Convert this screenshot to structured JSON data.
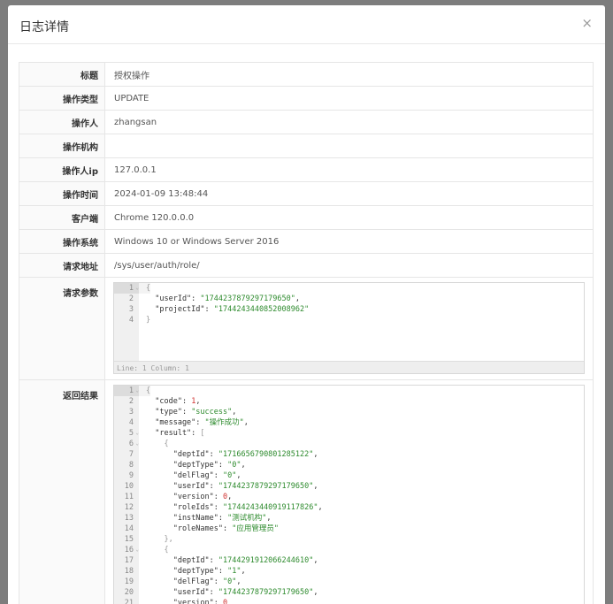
{
  "dialog": {
    "title": "日志详情",
    "close_glyph": "×"
  },
  "fields": [
    {
      "label": "标题",
      "value": "授权操作"
    },
    {
      "label": "操作类型",
      "value": "UPDATE"
    },
    {
      "label": "操作人",
      "value": "zhangsan"
    },
    {
      "label": "操作机构",
      "value": ""
    },
    {
      "label": "操作人ip",
      "value": "127.0.0.1"
    },
    {
      "label": "操作时间",
      "value": "2024-01-09 13:48:44"
    },
    {
      "label": "客户端",
      "value": "Chrome 120.0.0.0"
    },
    {
      "label": "操作系统",
      "value": "Windows 10 or Windows Server 2016"
    },
    {
      "label": "请求地址",
      "value": "/sys/user/auth/role/"
    }
  ],
  "request_params": {
    "label": "请求参数",
    "status": "Line: 1  Column: 1",
    "lines": [
      {
        "n": "1",
        "fold": true,
        "tokens": [
          {
            "t": "brk",
            "v": "{"
          }
        ]
      },
      {
        "n": "2",
        "fold": false,
        "tokens": [
          {
            "t": "key",
            "v": "  \"userId\": "
          },
          {
            "t": "str",
            "v": "\"1744237879297179650\""
          },
          {
            "t": "key",
            "v": ","
          }
        ]
      },
      {
        "n": "3",
        "fold": false,
        "tokens": [
          {
            "t": "key",
            "v": "  \"projectId\": "
          },
          {
            "t": "str",
            "v": "\"1744243440852008962\""
          }
        ]
      },
      {
        "n": "4",
        "fold": false,
        "tokens": [
          {
            "t": "brk",
            "v": "}"
          }
        ]
      }
    ]
  },
  "response": {
    "label": "返回结果",
    "lines": [
      {
        "n": "1",
        "fold": true,
        "tokens": [
          {
            "t": "brk",
            "v": "{"
          }
        ]
      },
      {
        "n": "2",
        "fold": false,
        "tokens": [
          {
            "t": "key",
            "v": "  \"code\": "
          },
          {
            "t": "num",
            "v": "1"
          },
          {
            "t": "key",
            "v": ","
          }
        ]
      },
      {
        "n": "3",
        "fold": false,
        "tokens": [
          {
            "t": "key",
            "v": "  \"type\": "
          },
          {
            "t": "str",
            "v": "\"success\""
          },
          {
            "t": "key",
            "v": ","
          }
        ]
      },
      {
        "n": "4",
        "fold": false,
        "tokens": [
          {
            "t": "key",
            "v": "  \"message\": "
          },
          {
            "t": "str",
            "v": "\"操作成功\""
          },
          {
            "t": "key",
            "v": ","
          }
        ]
      },
      {
        "n": "5",
        "fold": true,
        "tokens": [
          {
            "t": "key",
            "v": "  \"result\": "
          },
          {
            "t": "brk",
            "v": "["
          }
        ]
      },
      {
        "n": "6",
        "fold": true,
        "tokens": [
          {
            "t": "brk",
            "v": "    {"
          }
        ]
      },
      {
        "n": "7",
        "fold": false,
        "tokens": [
          {
            "t": "key",
            "v": "      \"deptId\": "
          },
          {
            "t": "str",
            "v": "\"1716656790801285122\""
          },
          {
            "t": "key",
            "v": ","
          }
        ]
      },
      {
        "n": "8",
        "fold": false,
        "tokens": [
          {
            "t": "key",
            "v": "      \"deptType\": "
          },
          {
            "t": "str",
            "v": "\"0\""
          },
          {
            "t": "key",
            "v": ","
          }
        ]
      },
      {
        "n": "9",
        "fold": false,
        "tokens": [
          {
            "t": "key",
            "v": "      \"delFlag\": "
          },
          {
            "t": "str",
            "v": "\"0\""
          },
          {
            "t": "key",
            "v": ","
          }
        ]
      },
      {
        "n": "10",
        "fold": false,
        "tokens": [
          {
            "t": "key",
            "v": "      \"userId\": "
          },
          {
            "t": "str",
            "v": "\"1744237879297179650\""
          },
          {
            "t": "key",
            "v": ","
          }
        ]
      },
      {
        "n": "11",
        "fold": false,
        "tokens": [
          {
            "t": "key",
            "v": "      \"version\": "
          },
          {
            "t": "num",
            "v": "0"
          },
          {
            "t": "key",
            "v": ","
          }
        ]
      },
      {
        "n": "12",
        "fold": false,
        "tokens": [
          {
            "t": "key",
            "v": "      \"roleIds\": "
          },
          {
            "t": "str",
            "v": "\"1744243440919117826\""
          },
          {
            "t": "key",
            "v": ","
          }
        ]
      },
      {
        "n": "13",
        "fold": false,
        "tokens": [
          {
            "t": "key",
            "v": "      \"instName\": "
          },
          {
            "t": "str",
            "v": "\"测试机构\""
          },
          {
            "t": "key",
            "v": ","
          }
        ]
      },
      {
        "n": "14",
        "fold": false,
        "tokens": [
          {
            "t": "key",
            "v": "      \"roleNames\": "
          },
          {
            "t": "str",
            "v": "\"应用管理员\""
          }
        ]
      },
      {
        "n": "15",
        "fold": false,
        "tokens": [
          {
            "t": "brk",
            "v": "    },"
          }
        ]
      },
      {
        "n": "16",
        "fold": true,
        "tokens": [
          {
            "t": "brk",
            "v": "    {"
          }
        ]
      },
      {
        "n": "17",
        "fold": false,
        "tokens": [
          {
            "t": "key",
            "v": "      \"deptId\": "
          },
          {
            "t": "str",
            "v": "\"1744291912066244610\""
          },
          {
            "t": "key",
            "v": ","
          }
        ]
      },
      {
        "n": "18",
        "fold": false,
        "tokens": [
          {
            "t": "key",
            "v": "      \"deptType\": "
          },
          {
            "t": "str",
            "v": "\"1\""
          },
          {
            "t": "key",
            "v": ","
          }
        ]
      },
      {
        "n": "19",
        "fold": false,
        "tokens": [
          {
            "t": "key",
            "v": "      \"delFlag\": "
          },
          {
            "t": "str",
            "v": "\"0\""
          },
          {
            "t": "key",
            "v": ","
          }
        ]
      },
      {
        "n": "20",
        "fold": false,
        "tokens": [
          {
            "t": "key",
            "v": "      \"userId\": "
          },
          {
            "t": "str",
            "v": "\"1744237879297179650\""
          },
          {
            "t": "key",
            "v": ","
          }
        ]
      },
      {
        "n": "21",
        "fold": false,
        "tokens": [
          {
            "t": "key",
            "v": "      \"version\": "
          },
          {
            "t": "num",
            "v": "0"
          }
        ]
      }
    ]
  }
}
